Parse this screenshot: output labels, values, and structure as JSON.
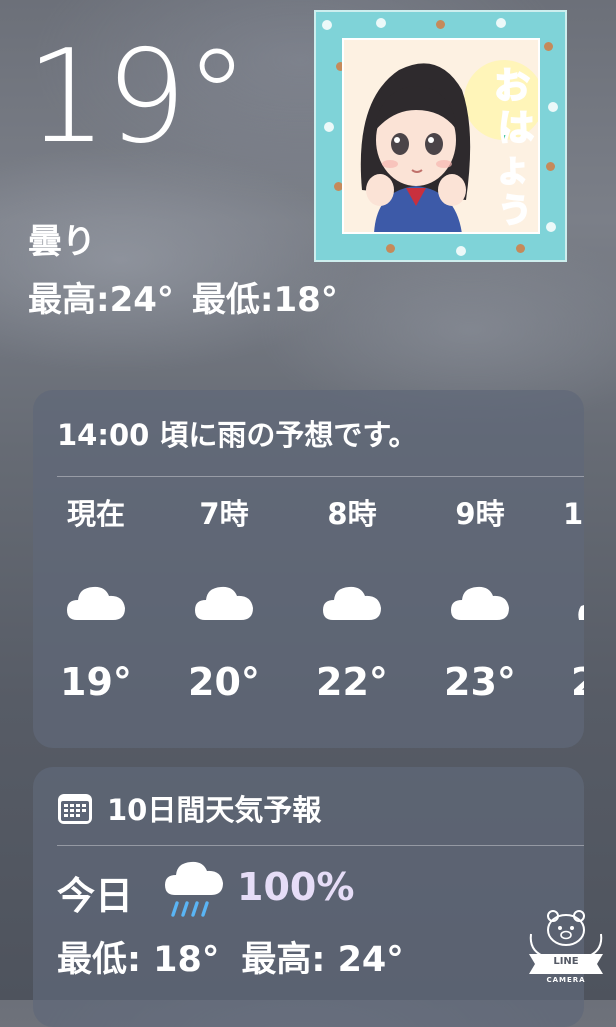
{
  "current": {
    "temperature": "19°",
    "condition": "曇り",
    "high": "最高:24°",
    "low": "最低:18°"
  },
  "sticker": {
    "text": "おはよう"
  },
  "hourly": {
    "summary": "14:00 頃に雨の予想です。",
    "items": [
      {
        "label": "現在",
        "icon": "cloud-icon",
        "temp": "19°"
      },
      {
        "label": "7時",
        "icon": "cloud-icon",
        "temp": "20°"
      },
      {
        "label": "8時",
        "icon": "cloud-icon",
        "temp": "22°"
      },
      {
        "label": "9時",
        "icon": "cloud-icon",
        "temp": "23°"
      },
      {
        "label": "1",
        "icon": "cloud-icon",
        "temp": "2"
      }
    ]
  },
  "daily": {
    "title": "10日間天気予報",
    "title_icon": "calendar-icon",
    "rows": [
      {
        "day": "今日",
        "icon": "rain-icon",
        "precip": "100%",
        "low": "最低: 18°",
        "high": "最高: 24°"
      }
    ]
  },
  "watermark": {
    "line1": "LINE",
    "line2": "CAMERA"
  },
  "colors": {
    "precip": "#e6ddf7",
    "rain_drops": "#5ab4f4",
    "card_bg": "rgba(95,104,120,0.72)"
  }
}
